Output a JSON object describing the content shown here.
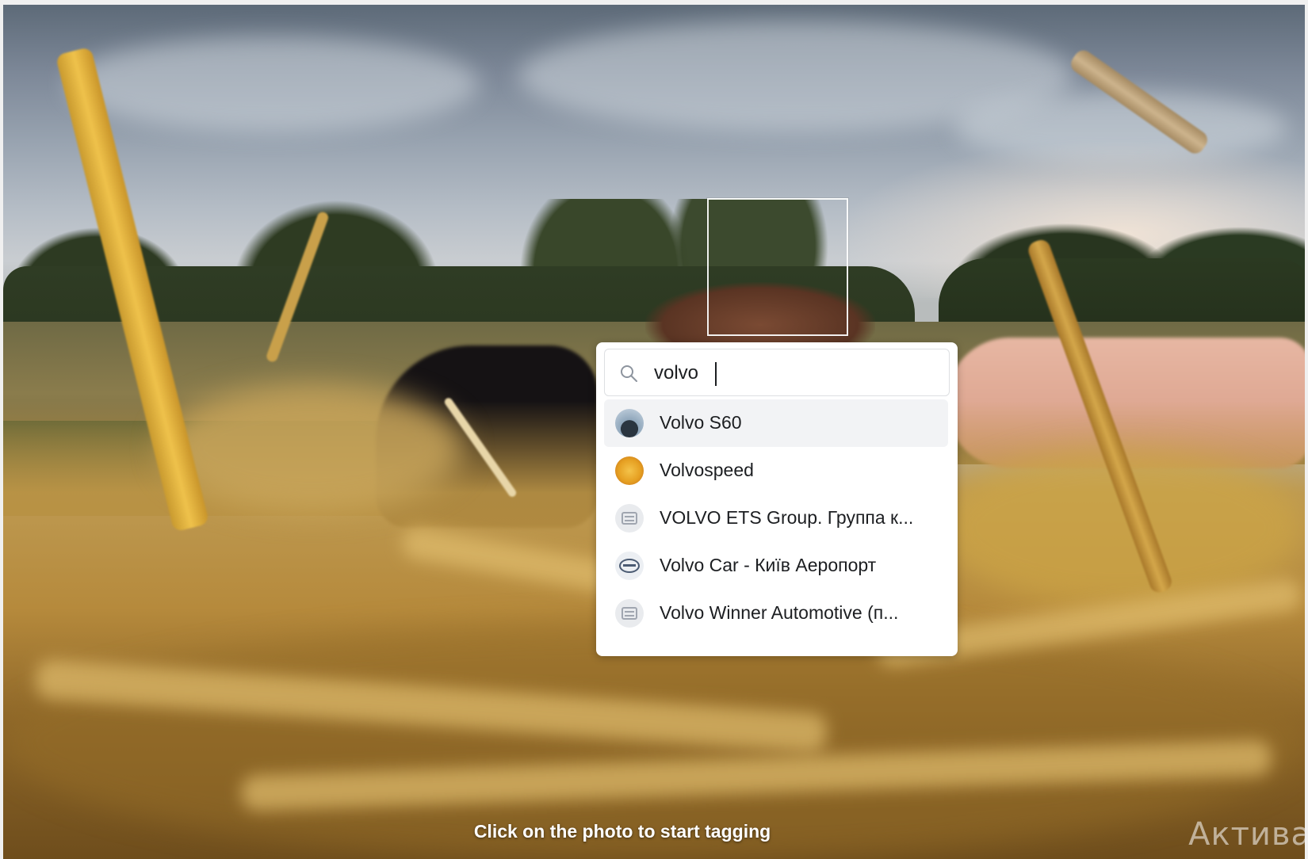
{
  "tagging": {
    "search": {
      "value": "volvo",
      "icon": "search-icon"
    },
    "suggestions": [
      {
        "label": "Volvo S60",
        "icon": "car-photo-avatar",
        "highlighted": true
      },
      {
        "label": "Volvospeed",
        "icon": "speed-logo-avatar",
        "highlighted": false
      },
      {
        "label": "VOLVO ETS Group. Группа к...",
        "icon": "page-icon",
        "highlighted": false
      },
      {
        "label": "Volvo Car - Київ Аеропорт",
        "icon": "volvo-logo-avatar",
        "highlighted": false
      },
      {
        "label": "Volvo Winner Automotive (п...",
        "icon": "page-icon",
        "highlighted": false
      }
    ]
  },
  "hint": "Click on the photo to start tagging",
  "watermark": "Актива"
}
